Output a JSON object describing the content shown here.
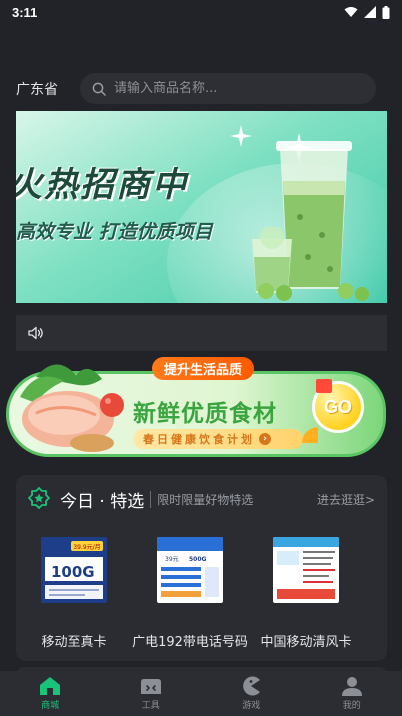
{
  "status_bar": {
    "time": "3:11"
  },
  "header": {
    "province": "广东省",
    "search_placeholder": "请输入商品名称..."
  },
  "banner": {
    "title": "火热招商中",
    "subtitle": "高效专业 打造优质项目"
  },
  "promo": {
    "badge": "提升生活品质",
    "title": "新鲜优质食材",
    "plan": "春日健康饮食计划",
    "go_label": "GO"
  },
  "today": {
    "title": "今日 · 特选",
    "desc": "限时限量好物特选",
    "more": "进去逛逛>",
    "items": [
      {
        "name": "移动至真卡",
        "price_tag": "39.9元/月",
        "data_tag": "100G"
      },
      {
        "name": "广电192带电话号码",
        "price_tag": "39元",
        "data_tag": "500G"
      },
      {
        "name": "中国移动清风卡"
      }
    ]
  },
  "tabbar": {
    "items": [
      {
        "label": "商城",
        "active": true
      },
      {
        "label": "工具",
        "active": false
      },
      {
        "label": "游戏",
        "active": false
      },
      {
        "label": "我的",
        "active": false
      }
    ]
  },
  "colors": {
    "accent": "#19c37a",
    "background": "#222328",
    "card": "#2a2c32"
  }
}
